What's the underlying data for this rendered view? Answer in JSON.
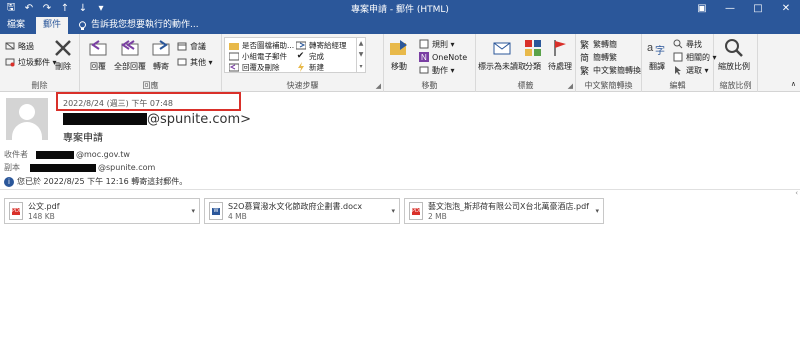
{
  "window": {
    "title": "專案申請 - 郵件 (HTML)",
    "min_glyph": "—",
    "max_glyph": "□",
    "close_glyph": "✕",
    "ribbon_toggle_glyph": "▣"
  },
  "qat": {
    "save_glyph": "🖫",
    "undo_glyph": "↶",
    "redo_glyph": "↷",
    "up_glyph": "↑",
    "down_glyph": "↓",
    "more_glyph": "▾"
  },
  "tabs": {
    "file": "檔案",
    "message": "郵件"
  },
  "tell_me": {
    "icon": "lightbulb-icon",
    "text": "告訴我您想要執行的動作..."
  },
  "ribbon": {
    "delete_group": {
      "ignore": "略過",
      "junk": "垃圾郵件 ▾",
      "delete": "刪除",
      "label": "刪除"
    },
    "respond_group": {
      "reply": "回覆",
      "reply_all": "全部回覆",
      "forward": "轉寄",
      "meeting": "會議",
      "more": "其他 ▾",
      "label": "回應"
    },
    "quick_steps": {
      "items": [
        "是否圖檔補助...",
        "小組電子郵件",
        "回覆及刪除",
        "轉寄給經理",
        "完成",
        "新建"
      ],
      "label": "快速步驟"
    },
    "move_group": {
      "move": "移動",
      "rules": "規則 ▾",
      "onenote": "OneNote",
      "actions": "動作 ▾",
      "label": "移動"
    },
    "tags_group": {
      "mark_unread": "標示為未讀取",
      "categorize": "分類",
      "follow_up": "待處理",
      "label": "標籤"
    },
    "chinese_group": {
      "to_trad": "繁轉簡",
      "to_simp": "簡轉繁",
      "convert": "中文繁簡轉換",
      "label": "中文繁簡轉換"
    },
    "edit_group": {
      "translate": "翻譯",
      "find": "尋找",
      "related": "相關的 ▾",
      "select": "選取 ▾",
      "label": "編輯"
    },
    "zoom_group": {
      "zoom": "縮放比例",
      "label": "縮放比例"
    }
  },
  "message": {
    "date": "2022/8/24 (週三) 下午 07:48",
    "sender_suffix": "@spunite.com>",
    "subject": "專案申請",
    "to_label": "收件者",
    "to_suffix": "@moc.gov.tw",
    "cc_label": "副本",
    "cc_suffix": "@spunite.com",
    "info": "您已於 2022/8/25 下午 12:16 轉寄這封郵件。",
    "attachments": [
      {
        "name": "公文.pdf",
        "size": "148 KB",
        "type": "pdf"
      },
      {
        "name": "S2O慕寶潑水文化節政府企劃書.docx",
        "size": "4 MB",
        "type": "docx"
      },
      {
        "name": "藝文泡泡_斯邦荷有限公司X台北萬豪酒店.pdf",
        "size": "2 MB",
        "type": "pdf"
      }
    ]
  },
  "colors": {
    "brand": "#2b579a",
    "highlight": "#d9302a",
    "pdf": "#d9302a",
    "word": "#2b579a"
  }
}
